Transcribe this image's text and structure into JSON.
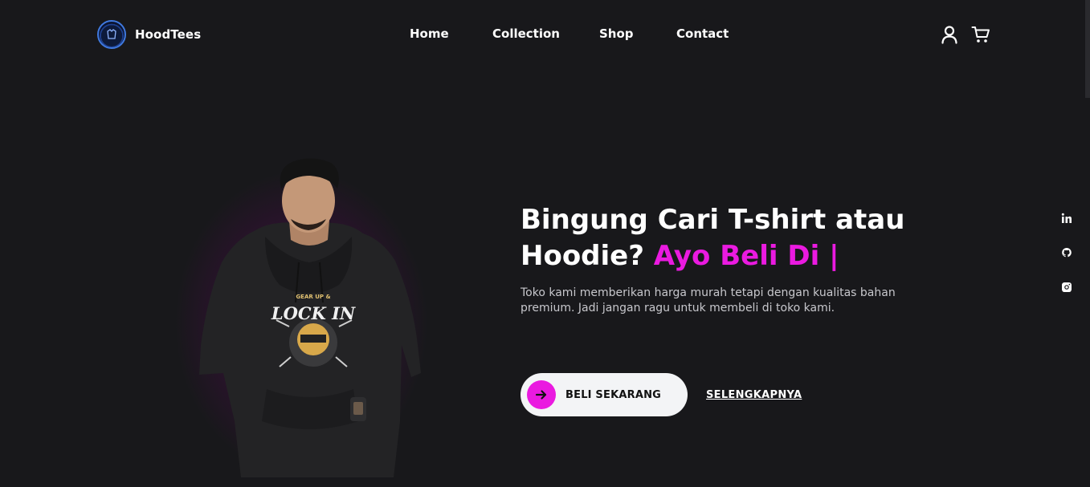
{
  "brand": {
    "name": "HoodTees",
    "logo_icon": "hoodtees-badge-icon"
  },
  "nav": {
    "items": [
      {
        "label": "Home"
      },
      {
        "label": "Collection"
      },
      {
        "label": "Shop"
      },
      {
        "label": "Contact"
      }
    ]
  },
  "header_icons": [
    "user-icon",
    "cart-icon"
  ],
  "social": [
    "linkedin-icon",
    "github-icon",
    "instagram-icon"
  ],
  "hero": {
    "title_main": "Bingung Cari T-shirt atau Hoodie?",
    "title_accent": "Ayo Beli Di |",
    "description": "Toko kami memberikan harga murah tetapi dengan kualitas bahan premium. Jadi jangan ragu untuk membeli di toko kami.",
    "cta_label": "BELI SEKARANG",
    "cta_icon": "arrow-right-icon",
    "more_label": "SELENGKAPNYA",
    "shirt_print_top": "GEAR UP &",
    "shirt_print_main": "LOCK IN"
  },
  "colors": {
    "background": "#18181b",
    "accent": "#ea1ae0",
    "button_bg": "#f3f4f6",
    "text": "#ffffff",
    "muted_text": "#c7c7cc"
  }
}
